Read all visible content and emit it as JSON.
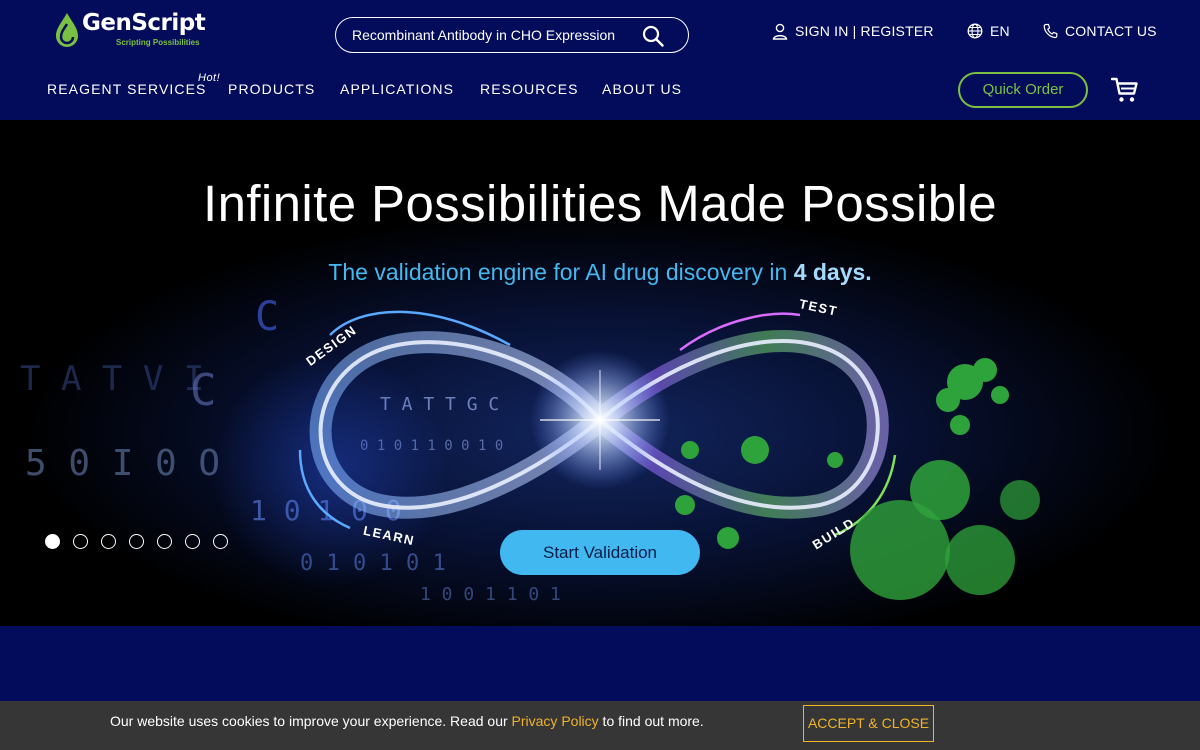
{
  "header": {
    "logo": {
      "name": "GenScript",
      "tagline": "Scripting Possibilities"
    },
    "search": {
      "placeholder": "Recombinant Antibody in CHO Expression",
      "icon": "search-icon"
    },
    "utility": {
      "signin": "SIGN IN | REGISTER",
      "language": "EN",
      "contact": "CONTACT US"
    },
    "nav": {
      "items": [
        {
          "label": "REAGENT SERVICES",
          "badge": "Hot!"
        },
        {
          "label": "PRODUCTS"
        },
        {
          "label": "APPLICATIONS"
        },
        {
          "label": "RESOURCES"
        },
        {
          "label": "ABOUT US"
        }
      ]
    },
    "quick_order": "Quick Order",
    "cart_icon": "cart-icon"
  },
  "hero": {
    "title": "Infinite Possibilities Made Possible",
    "subtitle_prefix": "The validation engine for AI drug discovery in ",
    "subtitle_highlight": "4 days.",
    "cycle": {
      "design": "DESIGN",
      "test": "TEST",
      "build": "BUILD",
      "learn": "LEARN"
    },
    "cta": "Start Validation",
    "carousel": {
      "slides": 7,
      "active": 1
    }
  },
  "cookie": {
    "text_before": "Our website uses cookies to improve your experience. Read our ",
    "link": "Privacy Policy",
    "text_after": " to find out more.",
    "button": "ACCEPT & CLOSE"
  },
  "colors": {
    "header_bg": "#030c5a",
    "accent_green": "#7ac143",
    "accent_blue": "#41b8f0",
    "cookie_bg": "#363636",
    "cookie_accent": "#f0b429"
  }
}
